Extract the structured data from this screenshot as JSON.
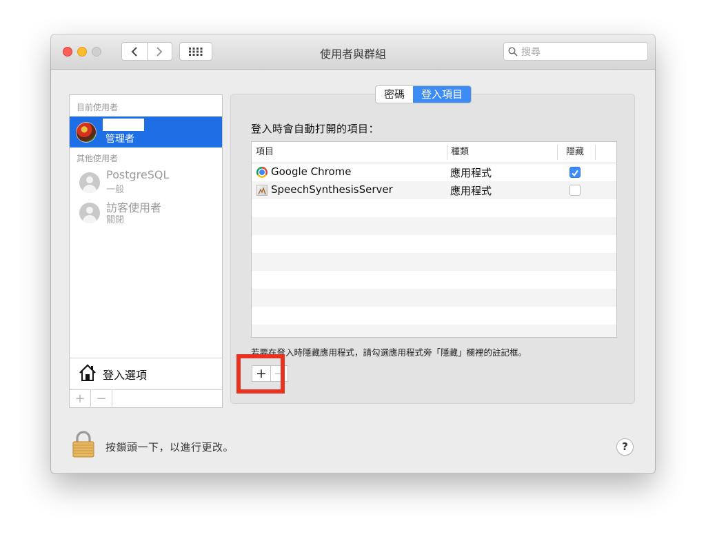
{
  "window": {
    "title": "使用者與群組",
    "search_placeholder": "搜尋"
  },
  "users": {
    "current_section": "目前使用者",
    "current_user": {
      "role": "管理者"
    },
    "other_section": "其他使用者",
    "others": [
      {
        "name": "PostgreSQL",
        "role": "一般"
      },
      {
        "name": "訪客使用者",
        "role": "關閉"
      }
    ],
    "login_options": "登入選項",
    "add_symbol": "+",
    "remove_symbol": "−"
  },
  "tabs": [
    {
      "label": "密碼",
      "active": false
    },
    {
      "label": "登入項目",
      "active": true
    }
  ],
  "login_items": {
    "heading": "登入時會自動打開的項目：",
    "columns": {
      "item": "項目",
      "kind": "種類",
      "hide": "隱藏"
    },
    "rows": [
      {
        "name": "Google Chrome",
        "kind": "應用程式",
        "hidden": true,
        "icon": "chrome-icon"
      },
      {
        "name": "SpeechSynthesisServer",
        "kind": "應用程式",
        "hidden": false,
        "icon": "speech-synthesis-icon"
      }
    ],
    "hint": "若要在登入時隱藏應用程式，請勾選應用程式旁「隱藏」欄裡的註記框。",
    "add_symbol": "+",
    "remove_symbol": "−"
  },
  "footer": {
    "lock_text": "按鎖頭一下，以進行更改。",
    "help_symbol": "?"
  },
  "colors": {
    "selection": "#1e6ee6",
    "segment_active": "#3d8bf5",
    "highlight": "#e8321f"
  }
}
